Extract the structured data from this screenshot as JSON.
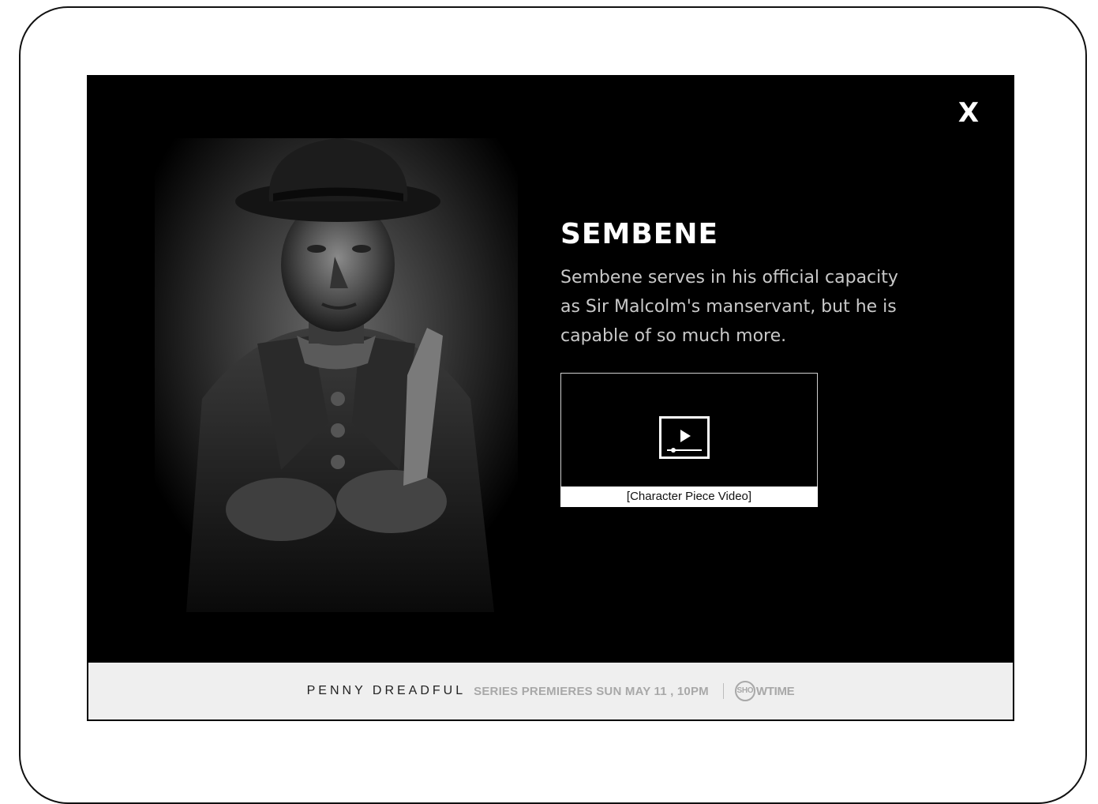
{
  "modal": {
    "close_label": "X",
    "character": {
      "name": "SEMBENE",
      "description": "Sembene serves in his official capacity as Sir Malcolm's manservant, but he is capable of so much more."
    },
    "video": {
      "caption": "[Character Piece Video]",
      "icon": "video-play-icon"
    },
    "portrait": {
      "icon": "character-portrait"
    }
  },
  "footer": {
    "show_title": "PENNY DREADFUL",
    "premiere_text": "SERIES PREMIERES SUN MAY 11 , 10PM",
    "network_mark": "SHO",
    "network_rest": "WTIME"
  },
  "colors": {
    "modal_bg": "#000000",
    "footer_bg": "#efefef",
    "footer_text": "#a8a8a8",
    "description_text": "#c9c9c9"
  }
}
